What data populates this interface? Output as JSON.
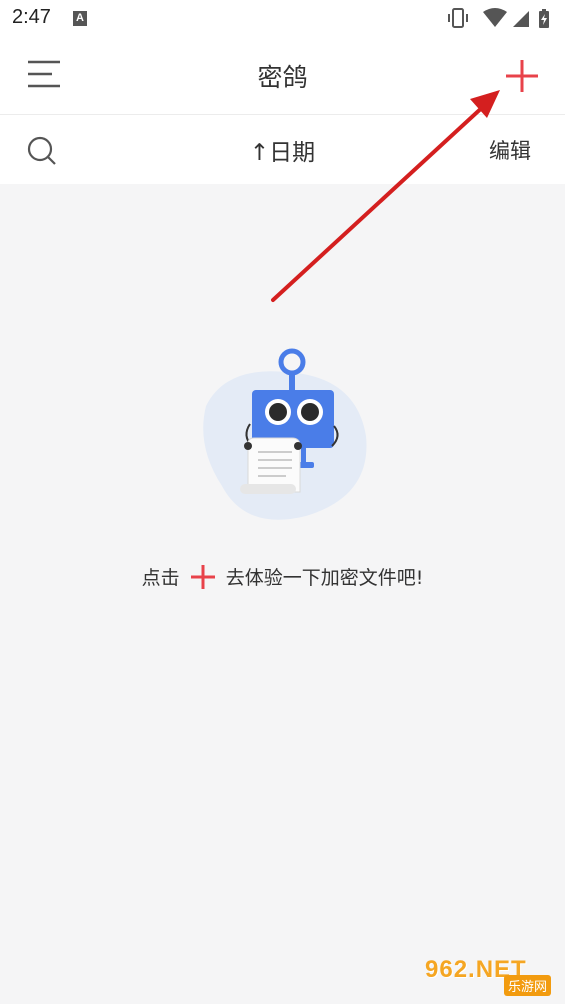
{
  "status_bar": {
    "time": "2:47",
    "notification_icon": "A",
    "icons": [
      "vibrate-icon",
      "wifi-icon",
      "signal-icon",
      "battery-icon"
    ]
  },
  "app_bar": {
    "title": "密鸽",
    "menu_icon": "menu-icon",
    "add_icon": "plus-icon",
    "accent_color": "#e8424a"
  },
  "toolbar": {
    "search_icon": "search-icon",
    "sort_label": "↑日期",
    "edit_label": "编辑"
  },
  "empty_state": {
    "illustration": "robot-with-document",
    "message_before": "点击",
    "message_icon": "plus-icon",
    "message_after": "去体验一下加密文件吧!"
  },
  "watermark": {
    "main": "962.NET",
    "sub": "乐游网"
  }
}
